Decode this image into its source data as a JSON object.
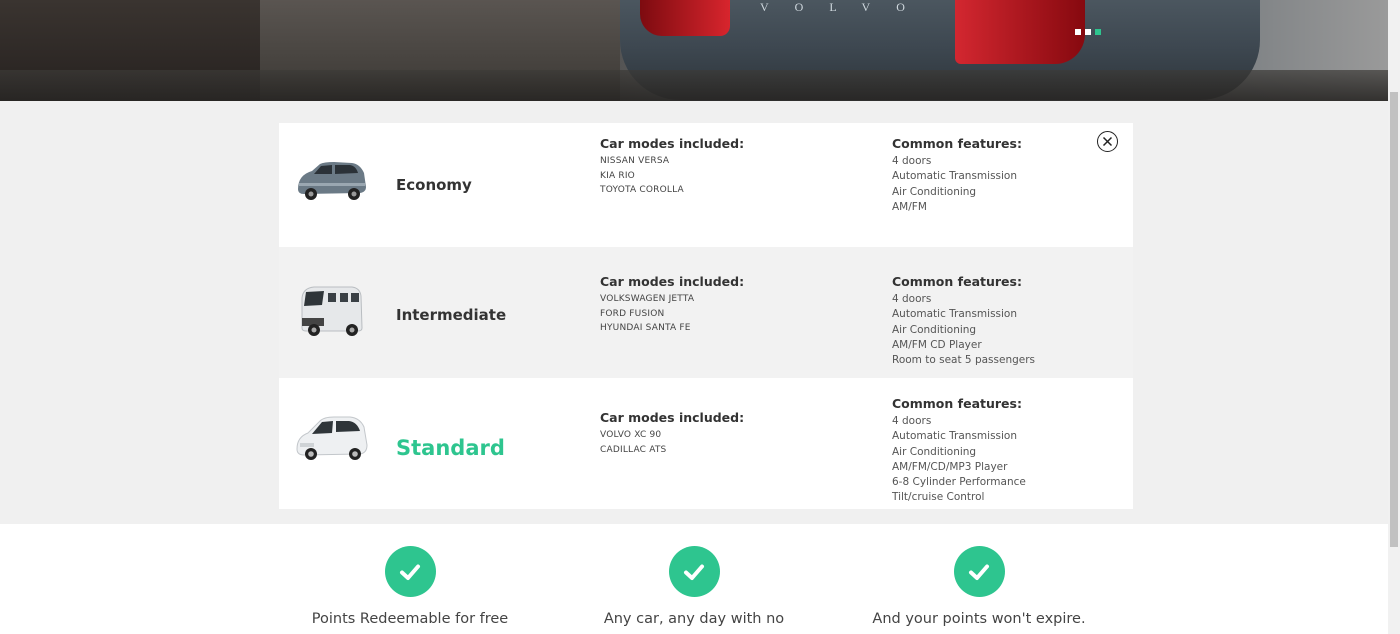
{
  "hero": {
    "car_brand": "VOLVO",
    "slider_dots": 3,
    "active_dot": 3
  },
  "categories": [
    {
      "name": "Economy",
      "models_heading": "Car modes included:",
      "models": [
        "NISSAN VERSA",
        "KIA RIO",
        "TOYOTA COROLLA"
      ],
      "features_heading": "Common features:",
      "features": [
        "4 doors",
        "Automatic Transmission",
        "Air Conditioning",
        "AM/FM"
      ]
    },
    {
      "name": "Intermediate",
      "models_heading": "Car modes included:",
      "models": [
        "VOLKSWAGEN JETTA",
        "FORD FUSION",
        "HYUNDAI SANTA FE"
      ],
      "features_heading": "Common features:",
      "features": [
        "4 doors",
        "Automatic Transmission",
        "Air Conditioning",
        "AM/FM CD Player",
        "Room to seat 5 passengers"
      ]
    },
    {
      "name": "Standard",
      "models_heading": "Car modes included:",
      "models": [
        "VOLVO XC 90",
        "CADILLAC ATS"
      ],
      "features_heading": "Common features:",
      "features": [
        "4 doors",
        "Automatic Transmission",
        "Air Conditioning",
        "AM/FM/CD/MP3 Player",
        "6-8 Cylinder Performance",
        "Tilt/cruise Control"
      ]
    }
  ],
  "selected_category": "Standard",
  "benefits": [
    {
      "icon": "check-icon",
      "text": "Points Redeemable for free"
    },
    {
      "icon": "check-icon",
      "text": "Any car, any day with no"
    },
    {
      "icon": "check-icon",
      "text": "And your points won't expire."
    }
  ],
  "colors": {
    "accent": "#2ec58f",
    "band_bg": "#f0f0f0"
  }
}
